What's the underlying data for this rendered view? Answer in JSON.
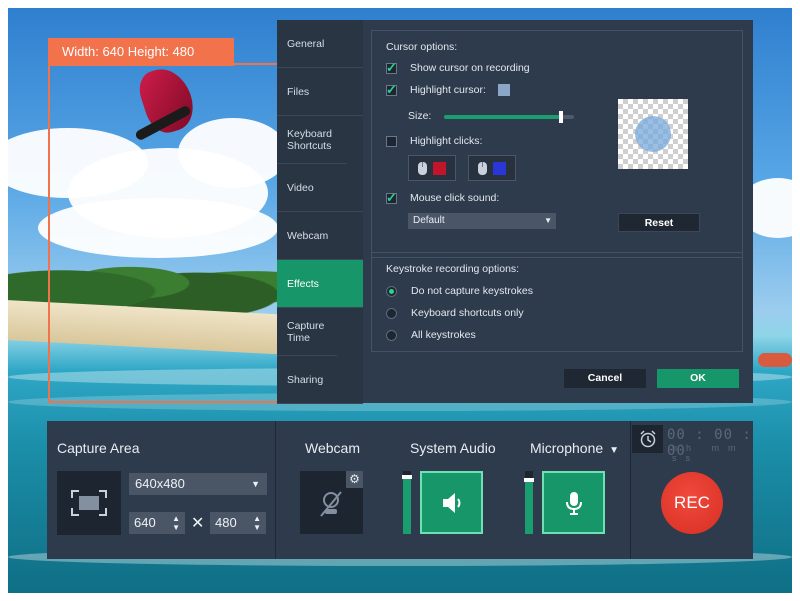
{
  "capture_frame": {
    "label": "Width: 640  Height: 480",
    "accent_color": "#f2724b"
  },
  "dialog": {
    "tabs": [
      {
        "label": "General"
      },
      {
        "label": "Files"
      },
      {
        "label": "Keyboard Shortcuts"
      },
      {
        "label": "Video"
      },
      {
        "label": "Webcam"
      },
      {
        "label": "Effects",
        "active": true
      },
      {
        "label": "Capture Time"
      },
      {
        "label": "Sharing"
      }
    ],
    "cursor_options": {
      "title": "Cursor options:",
      "show_cursor": {
        "label": "Show cursor on recording",
        "checked": true
      },
      "highlight_cursor": {
        "label": "Highlight cursor:",
        "checked": true,
        "color": "#8aa7c7"
      },
      "size": {
        "label": "Size:",
        "level": 0.9
      },
      "highlight_clicks": {
        "label": "Highlight clicks:",
        "checked": false,
        "left_color": "#c2142a",
        "right_color": "#2a37d8"
      },
      "mouse_click_sound": {
        "label": "Mouse click sound:",
        "checked": true
      },
      "sound_select": {
        "value": "Default"
      },
      "reset_label": "Reset"
    },
    "keystroke_options": {
      "title": "Keystroke recording options:",
      "options": [
        {
          "label": "Do not capture keystrokes",
          "selected": true
        },
        {
          "label": "Keyboard shortcuts only",
          "selected": false
        },
        {
          "label": "All keystrokes",
          "selected": false
        }
      ]
    },
    "cancel_label": "Cancel",
    "ok_label": "OK",
    "accent_color": "#17966a"
  },
  "bar": {
    "capture_area_label": "Capture Area",
    "resolution": "640x480",
    "width_value": "640",
    "times": "✕",
    "height_value": "480",
    "webcam_label": "Webcam",
    "system_audio_label": "System Audio",
    "system_audio_level": 0.9,
    "microphone_label": "Microphone",
    "microphone_level": 0.85,
    "timer": "00 : 00 : 00",
    "timer_units": "hh mm ss",
    "rec_label": "REC",
    "rec_color": "#e53a2f"
  }
}
